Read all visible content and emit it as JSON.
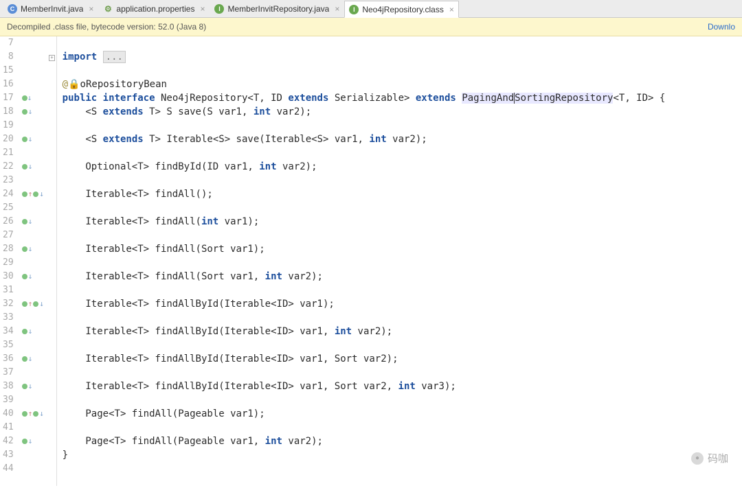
{
  "tabs": [
    {
      "label": "MemberInvit.java",
      "icon": "c",
      "active": false
    },
    {
      "label": "application.properties",
      "icon": "p",
      "active": false
    },
    {
      "label": "MemberInvitRepository.java",
      "icon": "i",
      "active": false
    },
    {
      "label": "Neo4jRepository.class",
      "icon": "ic",
      "active": true
    }
  ],
  "banner": {
    "message": "Decompiled .class file, bytecode version: 52.0 (Java 8)",
    "link": "Downlo"
  },
  "line_numbers": [
    "7",
    "8",
    "15",
    "16",
    "17",
    "18",
    "19",
    "20",
    "21",
    "22",
    "23",
    "24",
    "25",
    "26",
    "27",
    "28",
    "29",
    "30",
    "31",
    "32",
    "33",
    "34",
    "35",
    "36",
    "37",
    "38",
    "39",
    "40",
    "41",
    "42",
    "43",
    "44"
  ],
  "gutter_marks": {
    "1": "fold-plus",
    "4": "oi",
    "5": "od",
    "7": "od",
    "9": "od",
    "11": "ou-od",
    "13": "od",
    "15": "od",
    "17": "od",
    "19": "ou-od",
    "21": "od",
    "23": "od",
    "25": "od",
    "27": "ou-od",
    "29": "od"
  },
  "fold_ellipsis": "...",
  "annotation_prefix": "@",
  "java_keywords": {
    "import": "import",
    "public": "public",
    "interface": "interface",
    "extends": "extends",
    "int": "int"
  },
  "lines_plain": [
    "",
    "",
    "",
    "@NoRepositoryBean",
    "public interface Neo4jRepository<T, ID extends Serializable> extends PagingAndSortingRepository<T, ID> {",
    "    <S extends T> S save(S var1, int var2);",
    "",
    "    <S extends T> Iterable<S> save(Iterable<S> var1, int var2);",
    "",
    "    Optional<T> findById(ID var1, int var2);",
    "",
    "    Iterable<T> findAll();",
    "",
    "    Iterable<T> findAll(int var1);",
    "",
    "    Iterable<T> findAll(Sort var1);",
    "",
    "    Iterable<T> findAll(Sort var1, int var2);",
    "",
    "    Iterable<T> findAllById(Iterable<ID> var1);",
    "",
    "    Iterable<T> findAllById(Iterable<ID> var1, int var2);",
    "",
    "    Iterable<T> findAllById(Iterable<ID> var1, Sort var2);",
    "",
    "    Iterable<T> findAllById(Iterable<ID> var1, Sort var2, int var3);",
    "",
    "    Page<T> findAll(Pageable var1);",
    "",
    "    Page<T> findAll(Pageable var1, int var2);",
    "}",
    ""
  ],
  "highlight": {
    "word": "PagingAndSortingRepository",
    "cursor_at": "PagingAnd"
  },
  "watermark": "码咖"
}
